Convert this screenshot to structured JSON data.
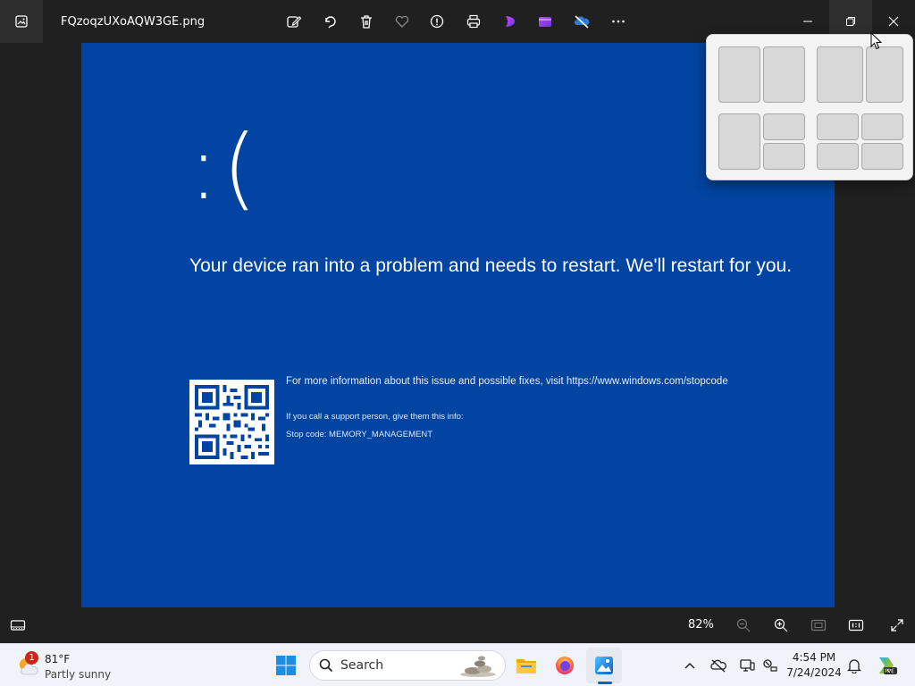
{
  "window": {
    "filename": "FQzoqzUXoAQW3GE.png"
  },
  "toolbar": {
    "icons": [
      "edit-image-icon",
      "rotate-icon",
      "delete-icon",
      "favorite-icon",
      "info-icon",
      "print-icon",
      "clipchamp-icon",
      "video-editor-icon",
      "onedrive-icon",
      "more-icon"
    ]
  },
  "image": {
    "sad_face": ":(",
    "message": "Your device ran into a problem and needs to restart. We'll restart for you.",
    "info_line": "For more information about this issue and possible fixes, visit https://www.windows.com/stopcode",
    "support_line": "If you call a support person, give them this info:",
    "stop_code": "Stop code: MEMORY_MANAGEMENT"
  },
  "colors": {
    "bsod_blue": "#0144a1",
    "app_bg": "#202020",
    "taskbar_bg": "#f0f3f9",
    "accent": "#0067c0"
  },
  "bottombar": {
    "zoom_level": "82%"
  },
  "taskbar": {
    "weather": {
      "temp": "81°F",
      "desc": "Partly sunny",
      "badge": "1"
    },
    "search_label": "Search",
    "clock": {
      "time": "4:54 PM",
      "date": "7/24/2024"
    }
  }
}
